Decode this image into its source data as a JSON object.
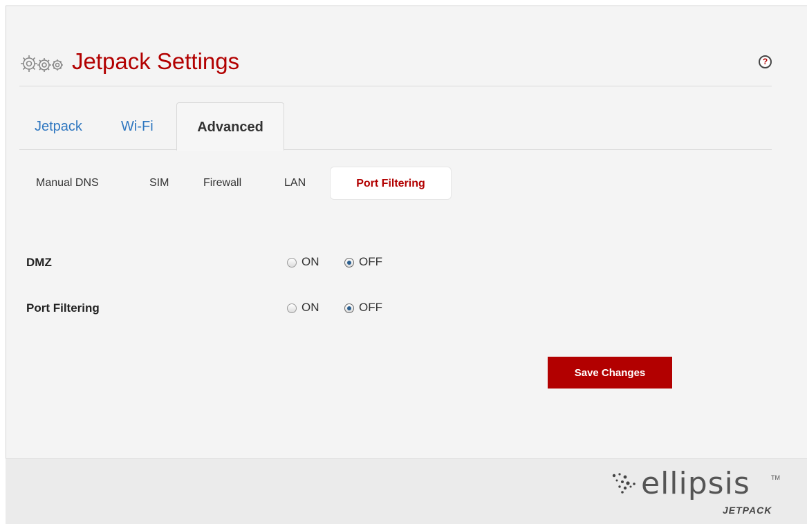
{
  "header": {
    "title": "Jetpack Settings",
    "help_label": "?"
  },
  "tabs": [
    {
      "label": "Jetpack",
      "active": false
    },
    {
      "label": "Wi-Fi",
      "active": false
    },
    {
      "label": "Advanced",
      "active": true
    }
  ],
  "subtabs": [
    {
      "label": "Manual DNS",
      "active": false
    },
    {
      "label": "SIM",
      "active": false
    },
    {
      "label": "Firewall",
      "active": false
    },
    {
      "label": "LAN",
      "active": false
    },
    {
      "label": "Port Filtering",
      "active": true
    }
  ],
  "settings": [
    {
      "label": "DMZ",
      "on_label": "ON",
      "off_label": "OFF",
      "selected": "OFF"
    },
    {
      "label": "Port Filtering",
      "on_label": "ON",
      "off_label": "OFF",
      "selected": "OFF"
    }
  ],
  "actions": {
    "save_label": "Save Changes"
  },
  "footer": {
    "logo_word": "ellipsis",
    "logo_tm": "TM",
    "logo_sub": "JETPACK"
  },
  "colors": {
    "accent": "#b20000",
    "link": "#2f77c0",
    "background": "#f4f4f4",
    "footer": "#ebebeb"
  }
}
